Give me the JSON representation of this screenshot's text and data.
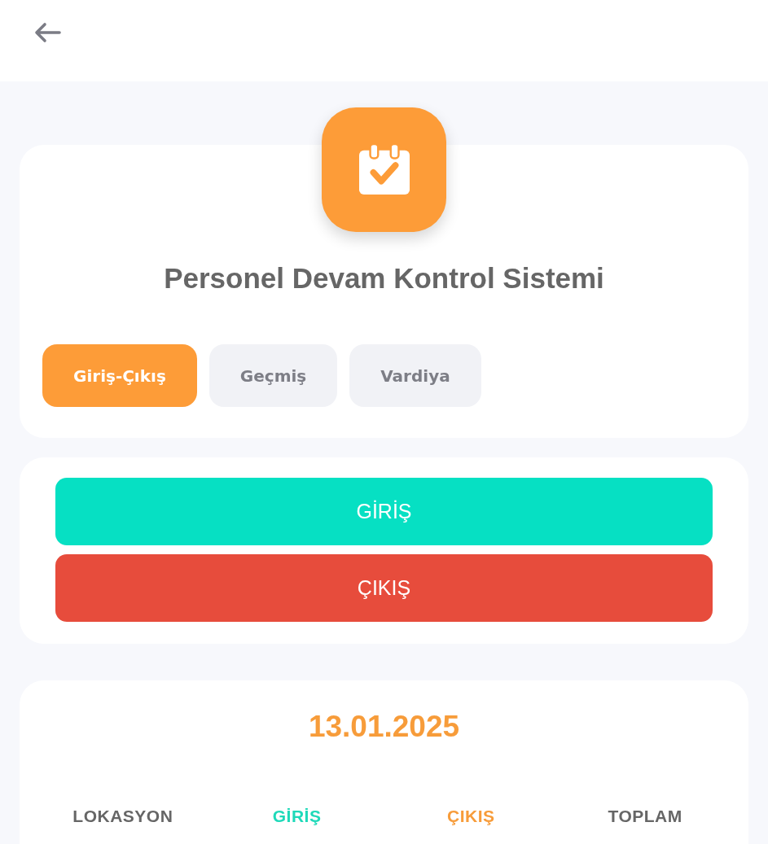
{
  "app": {
    "title": "Personel Devam Kontrol Sistemi"
  },
  "tabs": [
    {
      "label": "Giriş-Çıkış",
      "selected": true
    },
    {
      "label": "Geçmiş",
      "selected": false
    },
    {
      "label": "Vardiya",
      "selected": false
    }
  ],
  "actions": [
    {
      "label": "GİRİŞ",
      "color": "#06e0c3"
    },
    {
      "label": "ÇIKIŞ",
      "color": "#e74c3c"
    }
  ],
  "summary": {
    "date": "13.01.2025",
    "columns": [
      {
        "label": "LOKASYON",
        "color": "#666666"
      },
      {
        "label": "GİRİŞ",
        "color": "#1ed9b9"
      },
      {
        "label": "ÇIKIŞ",
        "color": "#f79c3a"
      },
      {
        "label": "TOPLAM",
        "color": "#666666"
      }
    ]
  }
}
